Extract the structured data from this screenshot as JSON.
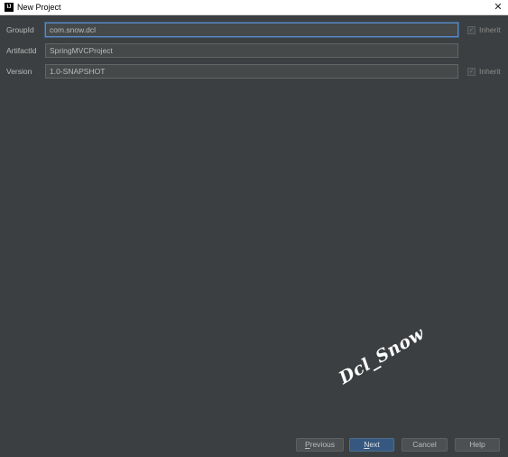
{
  "window": {
    "app_icon_text": "IJ",
    "title": "New Project",
    "close_glyph": "✕"
  },
  "form": {
    "group_id": {
      "label": "GroupId",
      "value": "com.snow.dcl",
      "inherit_label": "Inherit",
      "inherit_checked": true
    },
    "artifact_id": {
      "label": "ArtifactId",
      "value": "SpringMVCProject"
    },
    "version": {
      "label": "Version",
      "value": "1.0-SNAPSHOT",
      "inherit_label": "Inherit",
      "inherit_checked": true
    }
  },
  "watermark": "Dcl_Snow",
  "buttons": {
    "previous_first": "P",
    "previous_rest": "revious",
    "next_first": "N",
    "next_rest": "ext",
    "cancel": "Cancel",
    "help": "Help"
  },
  "icons": {
    "check_glyph": "✓"
  },
  "colors": {
    "background": "#3c3f41",
    "field_bg": "#45494a",
    "focus_border": "#5a8ac7",
    "primary_button": "#365880"
  }
}
